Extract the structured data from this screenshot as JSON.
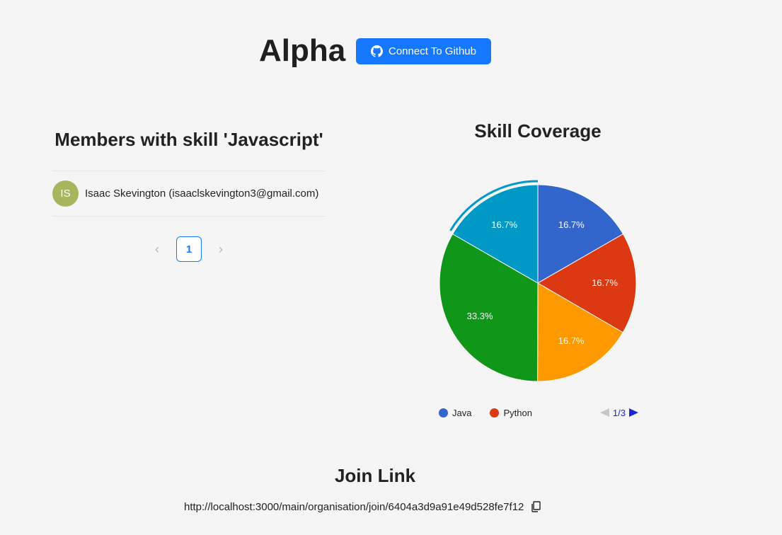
{
  "header": {
    "org_name": "Alpha",
    "github_button_label": "Connect To Github",
    "github_icon": "github-icon"
  },
  "members": {
    "title": "Members with skill 'Javascript'",
    "items": [
      {
        "initials": "IS",
        "label": "Isaac Skevington (isaaclskevington3@gmail.com)",
        "avatar_color": "#a7b55d"
      }
    ],
    "pagination": {
      "prev": "‹",
      "current_page": "1",
      "next": "›"
    }
  },
  "chart_data": {
    "type": "pie",
    "title": "Skill Coverage",
    "slices": [
      {
        "label": "Java",
        "value": 16.7,
        "display": "16.7%",
        "color": "#3366cc"
      },
      {
        "label": "Python",
        "value": 16.7,
        "display": "16.7%",
        "color": "#dc3912"
      },
      {
        "label": "",
        "value": 16.7,
        "display": "16.7%",
        "color": "#ff9900"
      },
      {
        "label": "",
        "value": 33.3,
        "display": "33.3%",
        "color": "#109618"
      },
      {
        "label": "",
        "value": 16.7,
        "display": "16.7%",
        "color": "#0099c6"
      }
    ],
    "highlighted_slice": 4,
    "legend": {
      "items": [
        {
          "label": "Java",
          "color": "#3366cc"
        },
        {
          "label": "Python",
          "color": "#dc3912"
        }
      ],
      "page": "1/3",
      "position": "bottom"
    }
  },
  "join": {
    "title": "Join Link",
    "url": "http://localhost:3000/main/organisation/join/6404a3d9a91e49d528fe7f12",
    "copy_icon": "copy-icon"
  }
}
